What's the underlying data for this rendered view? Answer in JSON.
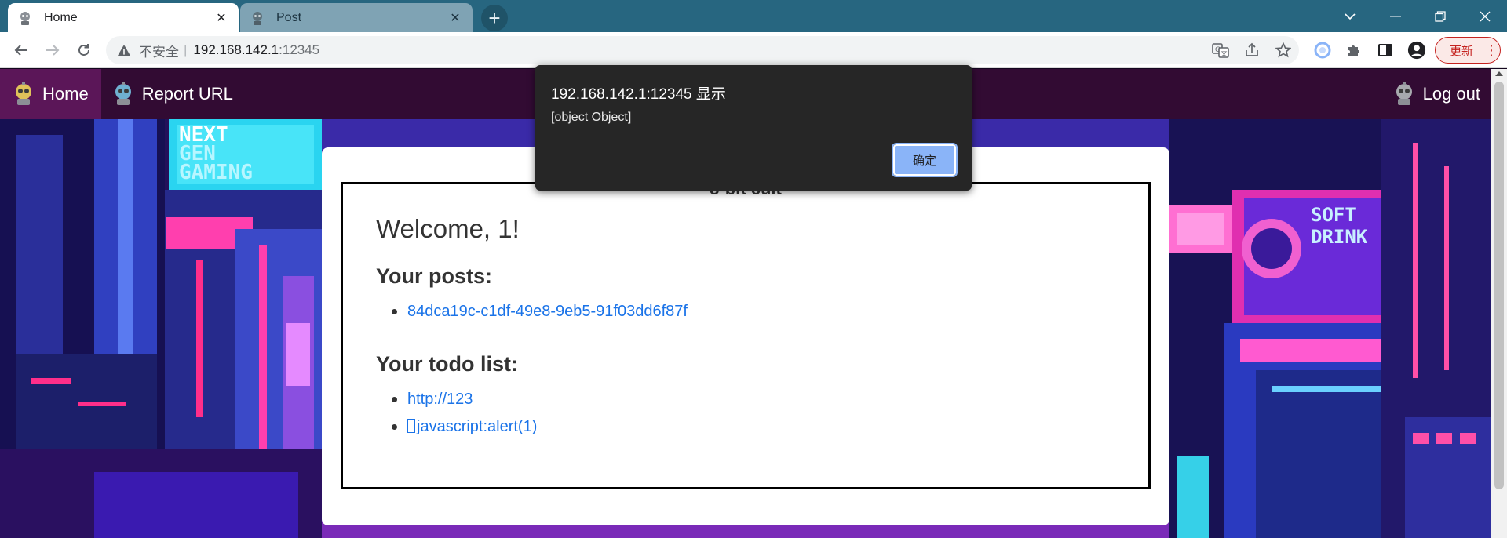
{
  "browser": {
    "tabs": [
      {
        "label": "Home",
        "active": true
      },
      {
        "label": "Post",
        "active": false
      }
    ],
    "new_tab_icon": "plus-icon",
    "window_controls": [
      "chevron-down-icon",
      "minimize-icon",
      "restore-icon",
      "close-icon"
    ],
    "address": {
      "security_label": "不安全",
      "separator": "|",
      "host": "192.168.142.1",
      "port": ":12345"
    },
    "toolbar_icons": [
      "translate-icon",
      "share-icon",
      "bookmark-star-icon",
      "extension-circle-icon",
      "puzzle-icon",
      "sidepanel-icon",
      "profile-icon"
    ],
    "update_label": "更新",
    "update_menu": "⋮"
  },
  "site": {
    "nav": {
      "home": "Home",
      "report": "Report URL",
      "logout": "Log out"
    },
    "title": "8-bit cult",
    "welcome": "Welcome, 1!",
    "posts_heading": "Your posts:",
    "posts": [
      "84dca19c-c1df-49e8-9eb5-91f03dd6f87f"
    ],
    "todo_heading": "Your todo list:",
    "todos": [
      "http://123",
      "javascript:alert(1)"
    ]
  },
  "alert": {
    "title": "192.168.142.1:12345 显示",
    "message": "[object Object]",
    "ok_label": "确定"
  },
  "colors": {
    "tabbar": "#276680",
    "site_nav": "#320b33",
    "site_nav_active": "#5b1658",
    "link": "#1a73e8",
    "alert_bg": "#262626",
    "alert_button": "#8ab4f8",
    "update_accent": "#c5221f"
  }
}
